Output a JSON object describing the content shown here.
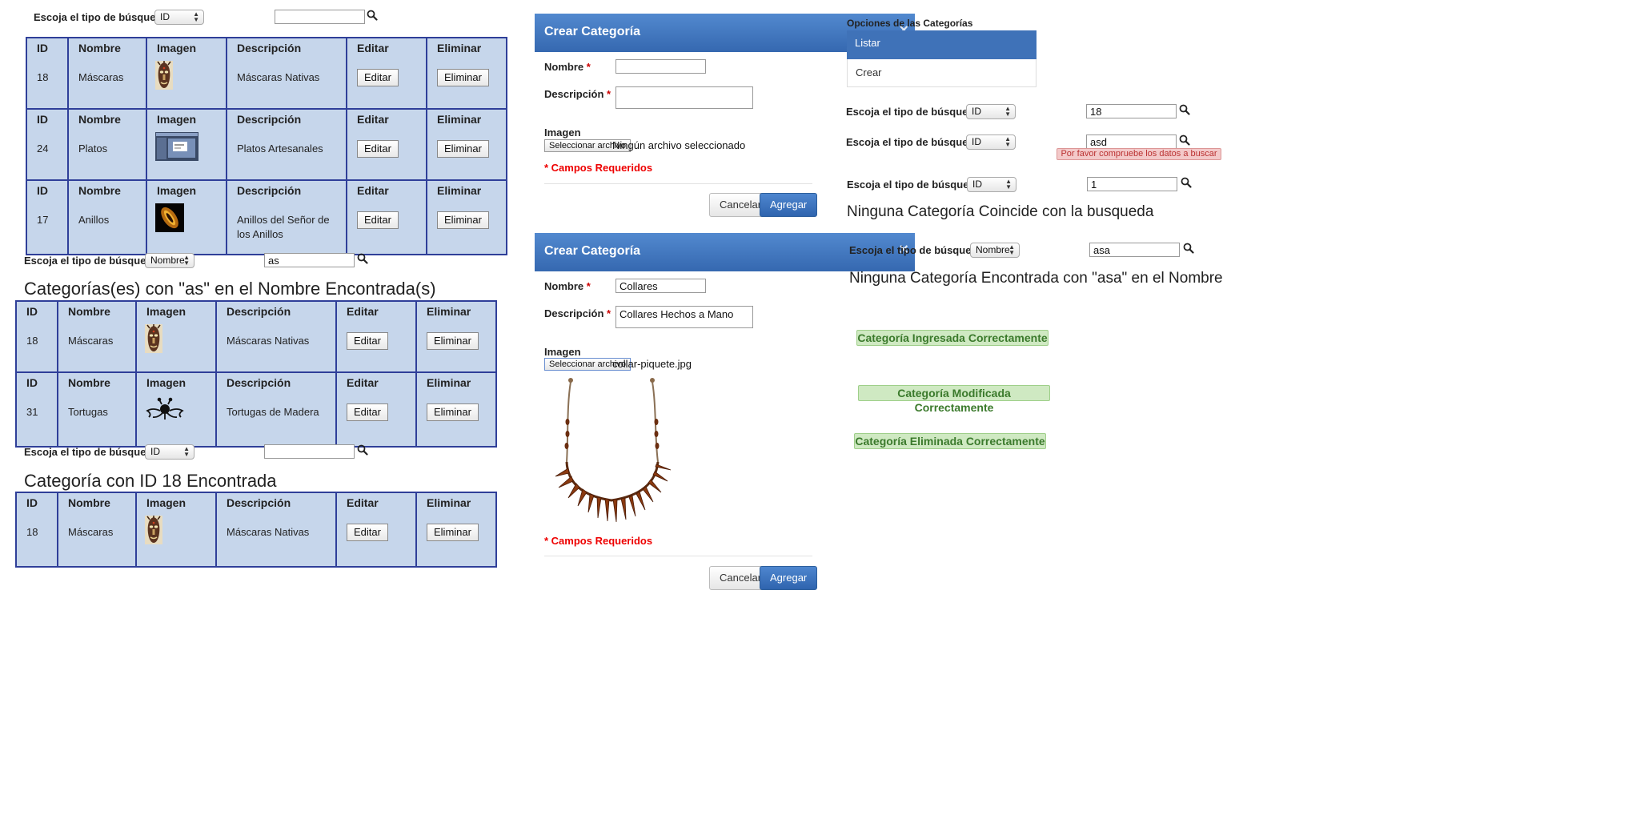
{
  "search_label": "Escoja el tipo de búsqueda",
  "headers": {
    "id": "ID",
    "nombre": "Nombre",
    "imagen": "Imagen",
    "descripcion": "Descripción",
    "editar": "Editar",
    "eliminar": "Eliminar"
  },
  "buttons": {
    "editar": "Editar",
    "eliminar": "Eliminar"
  },
  "left_top": {
    "search": {
      "type": "ID",
      "value": ""
    },
    "rows": [
      {
        "id": "18",
        "nombre": "Máscaras",
        "descripcion": "Máscaras Nativas",
        "image": "mask-image"
      },
      {
        "id": "24",
        "nombre": "Platos",
        "descripcion": "Platos Artesanales",
        "image": "screenshot-image"
      },
      {
        "id": "17",
        "nombre": "Anillos",
        "descripcion": "Anillos del Señor de los Anillos",
        "image": "ring-image"
      }
    ]
  },
  "left_mid": {
    "search": {
      "type": "Nombre",
      "value": "as"
    },
    "title": "Categorías(es) con \"as\" en el Nombre Encontrada(s)",
    "rows": [
      {
        "id": "18",
        "nombre": "Máscaras",
        "descripcion": "Máscaras Nativas",
        "image": "mask-image"
      },
      {
        "id": "31",
        "nombre": "Tortugas",
        "descripcion": "Tortugas de Madera",
        "image": "spaghetti-monster-image"
      }
    ]
  },
  "left_bottom": {
    "search": {
      "type": "ID",
      "value": ""
    },
    "title": "Categoría con ID 18 Encontrada",
    "rows": [
      {
        "id": "18",
        "nombre": "Máscaras",
        "descripcion": "Máscaras Nativas",
        "image": "mask-image"
      }
    ]
  },
  "modal1": {
    "title": "Crear Categoría",
    "close": "×",
    "nombre_label": "Nombre",
    "descripcion_label": "Descripción",
    "required_mark": "*",
    "nombre_value": "",
    "descripcion_value": "",
    "imagen_label": "Imagen",
    "file_button": "Seleccionar archivo",
    "file_status": "Ningún archivo seleccionado",
    "required_note": "* Campos Requeridos",
    "cancel": "Cancelar",
    "add": "Agregar"
  },
  "modal2": {
    "title": "Crear Categoría",
    "close": "×",
    "nombre_label": "Nombre",
    "descripcion_label": "Descripción",
    "required_mark": "*",
    "nombre_value": "Collares",
    "descripcion_value": "Collares Hechos a Mano",
    "imagen_label": "Imagen",
    "file_button": "Seleccionar archivo",
    "file_status": "collar-piquete.jpg",
    "required_note": "* Campos Requeridos",
    "cancel": "Cancelar",
    "add": "Agregar"
  },
  "options": {
    "title": "Opciones de las Categorías",
    "items": [
      "Listar",
      "Crear"
    ],
    "active": "Listar",
    "active_color": "#3f72b8"
  },
  "right_searches": [
    {
      "type": "ID",
      "value": "18"
    },
    {
      "type": "ID",
      "value": "asd",
      "error": "Por favor compruebe los datos a buscar"
    },
    {
      "type": "ID",
      "value": "1"
    },
    {
      "type": "Nombre",
      "value": "asa"
    }
  ],
  "right_messages": {
    "no_match": "Ninguna Categoría Coincide con la busqueda",
    "not_found_name": "Ninguna Categoría Encontrada con \"asa\" en el Nombre"
  },
  "success_alerts": [
    "Categoría Ingresada Correctamente",
    "Categoría Modificada Correctamente",
    "Categoría Eliminada Correctamente"
  ],
  "colors": {
    "table_bg": "#c6d6eb",
    "table_border": "#2f3f99",
    "modal_header": "#3d70b7",
    "required": "#e00000",
    "success_bg": "#cfe9c2",
    "error_bg": "#f3c9c9"
  }
}
